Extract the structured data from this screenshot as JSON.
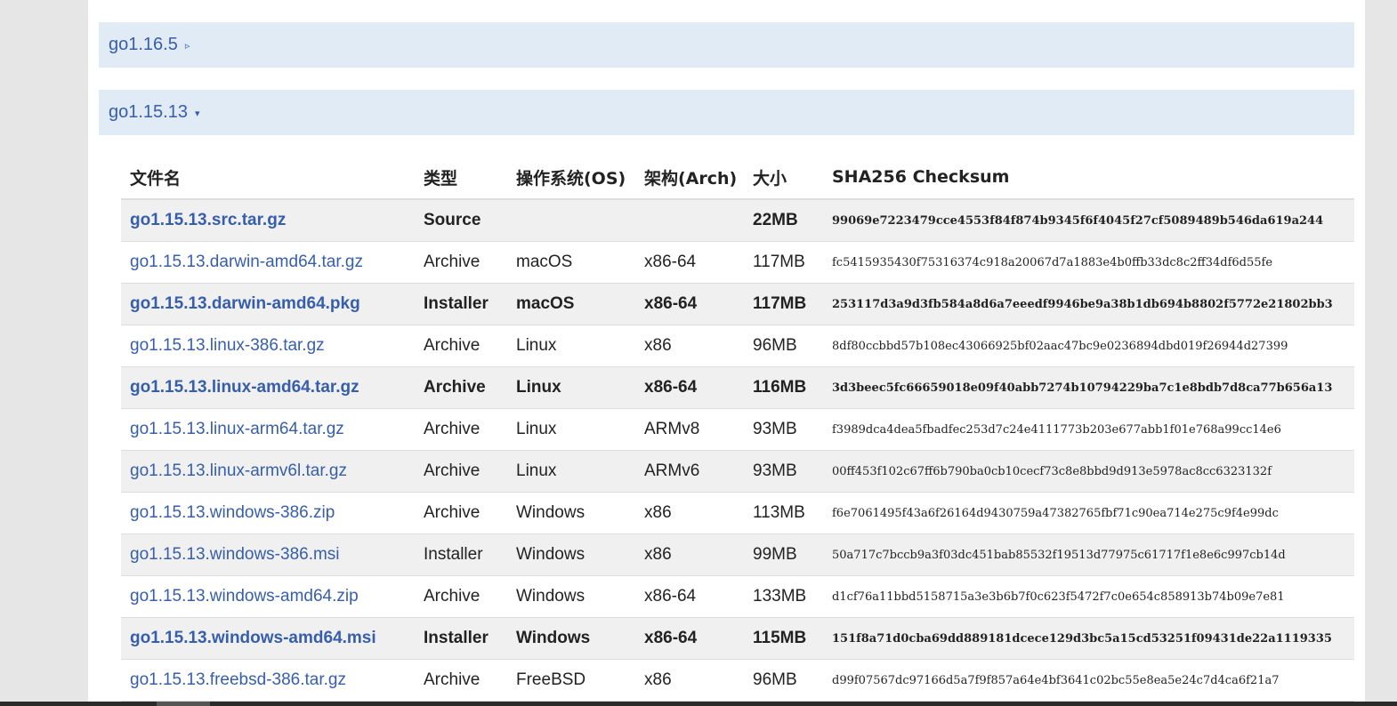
{
  "versions": [
    {
      "title": "go1.16.5",
      "toggle": "▹",
      "expanded": false
    },
    {
      "title": "go1.15.13",
      "toggle": "▾",
      "expanded": true
    }
  ],
  "table": {
    "headers": {
      "filename": "文件名",
      "kind": "类型",
      "os": "操作系统(OS)",
      "arch": "架构(Arch)",
      "size": "大小",
      "checksum": "SHA256 Checksum"
    },
    "rows": [
      {
        "filename": "go1.15.13.src.tar.gz",
        "kind": "Source",
        "os": "",
        "arch": "",
        "size": "22MB",
        "checksum": "99069e7223479cce4553f84f874b9345f6f4045f27cf5089489b546da619a244",
        "highlight": true
      },
      {
        "filename": "go1.15.13.darwin-amd64.tar.gz",
        "kind": "Archive",
        "os": "macOS",
        "arch": "x86-64",
        "size": "117MB",
        "checksum": "fc5415935430f75316374c918a20067d7a1883e4b0ffb33dc8c2ff34df6d55fe",
        "highlight": false
      },
      {
        "filename": "go1.15.13.darwin-amd64.pkg",
        "kind": "Installer",
        "os": "macOS",
        "arch": "x86-64",
        "size": "117MB",
        "checksum": "253117d3a9d3fb584a8d6a7eeedf9946be9a38b1db694b8802f5772e21802bb3",
        "highlight": true
      },
      {
        "filename": "go1.15.13.linux-386.tar.gz",
        "kind": "Archive",
        "os": "Linux",
        "arch": "x86",
        "size": "96MB",
        "checksum": "8df80ccbbd57b108ec43066925bf02aac47bc9e0236894dbd019f26944d27399",
        "highlight": false
      },
      {
        "filename": "go1.15.13.linux-amd64.tar.gz",
        "kind": "Archive",
        "os": "Linux",
        "arch": "x86-64",
        "size": "116MB",
        "checksum": "3d3beec5fc66659018e09f40abb7274b10794229ba7c1e8bdb7d8ca77b656a13",
        "highlight": true
      },
      {
        "filename": "go1.15.13.linux-arm64.tar.gz",
        "kind": "Archive",
        "os": "Linux",
        "arch": "ARMv8",
        "size": "93MB",
        "checksum": "f3989dca4dea5fbadfec253d7c24e4111773b203e677abb1f01e768a99cc14e6",
        "highlight": false
      },
      {
        "filename": "go1.15.13.linux-armv6l.tar.gz",
        "kind": "Archive",
        "os": "Linux",
        "arch": "ARMv6",
        "size": "93MB",
        "checksum": "00ff453f102c67ff6b790ba0cb10cecf73c8e8bbd9d913e5978ac8cc6323132f",
        "highlight": false,
        "shade": true
      },
      {
        "filename": "go1.15.13.windows-386.zip",
        "kind": "Archive",
        "os": "Windows",
        "arch": "x86",
        "size": "113MB",
        "checksum": "f6e7061495f43a6f26164d9430759a47382765fbf71c90ea714e275c9f4e99dc",
        "highlight": false
      },
      {
        "filename": "go1.15.13.windows-386.msi",
        "kind": "Installer",
        "os": "Windows",
        "arch": "x86",
        "size": "99MB",
        "checksum": "50a717c7bccb9a3f03dc451bab85532f19513d77975c61717f1e8e6c997cb14d",
        "highlight": false,
        "shade": true
      },
      {
        "filename": "go1.15.13.windows-amd64.zip",
        "kind": "Archive",
        "os": "Windows",
        "arch": "x86-64",
        "size": "133MB",
        "checksum": "d1cf76a11bbd5158715a3e3b6b7f0c623f5472f7c0e654c858913b74b09e7e81",
        "highlight": false
      },
      {
        "filename": "go1.15.13.windows-amd64.msi",
        "kind": "Installer",
        "os": "Windows",
        "arch": "x86-64",
        "size": "115MB",
        "checksum": "151f8a71d0cba69dd889181dcece129d3bc5a15cd53251f09431de22a1119335",
        "highlight": true
      },
      {
        "filename": "go1.15.13.freebsd-386.tar.gz",
        "kind": "Archive",
        "os": "FreeBSD",
        "arch": "x86",
        "size": "96MB",
        "checksum": "d99f07567dc97166d5a7f9f857a64e4bf3641c02bc55e8ea5e24c7d4ca6f21a7",
        "highlight": false
      }
    ]
  },
  "colors": {
    "link": "#375eab",
    "header_bg": "#e0ebf5",
    "row_highlight": "#f0f0f0"
  }
}
